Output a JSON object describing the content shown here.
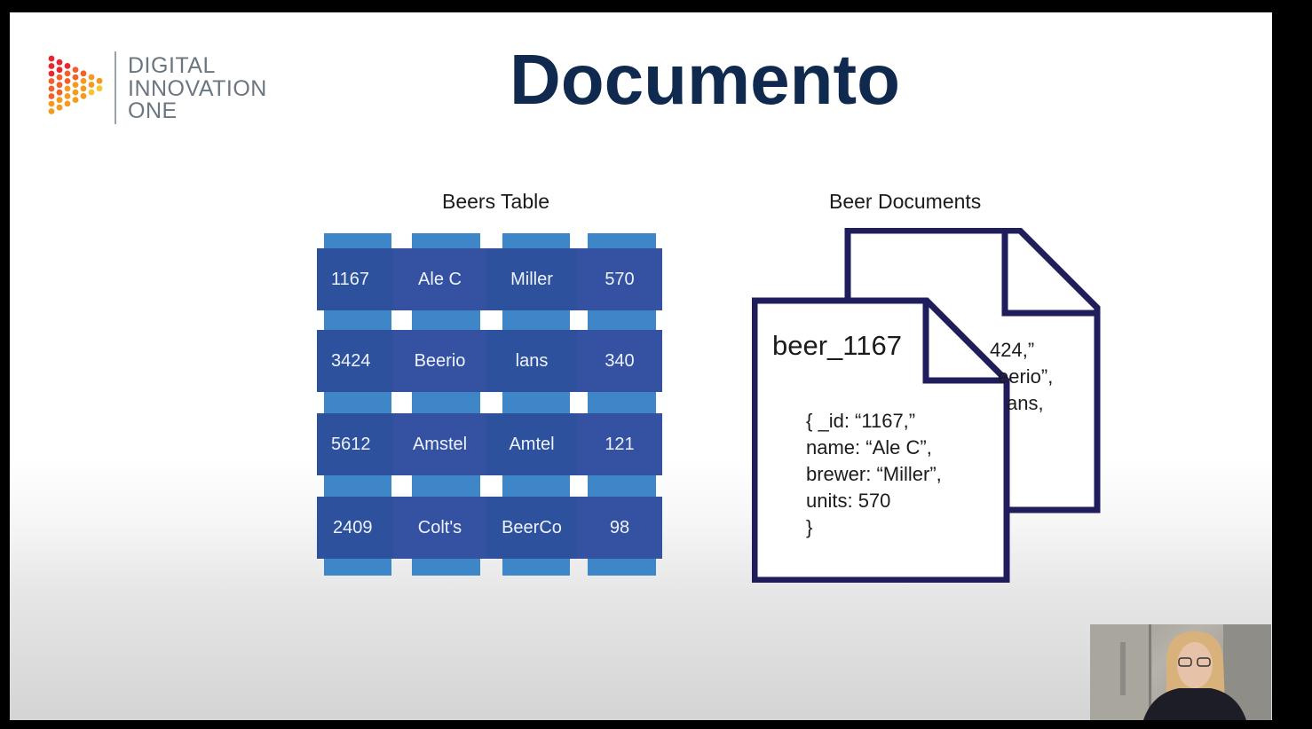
{
  "logo": {
    "lines": [
      "DIGITAL",
      "INNOVATION",
      "ONE"
    ],
    "icon": "dot-triangle-logo-icon",
    "colors": [
      "#e8262f",
      "#f2612a",
      "#f39a1f",
      "#f7c52c"
    ]
  },
  "slide": {
    "title": "Documento",
    "table_heading": "Beers Table",
    "docs_heading": "Beer Documents"
  },
  "table": {
    "rows": [
      [
        "1167",
        "Ale C",
        "Miller",
        "570"
      ],
      [
        "3424",
        "Beerio",
        "lans",
        "340"
      ],
      [
        "5612",
        "Amstel",
        "Amtel",
        "121"
      ],
      [
        "2409",
        "Colt's",
        "BeerCo",
        "98"
      ]
    ]
  },
  "document": {
    "label": "beer_1167",
    "lines": [
      "{ _id: “1167,”",
      "name: “Ale C”,",
      "brewer: “Miller”,",
      "units: 570",
      "}"
    ],
    "back_fragments": [
      "424,”",
      "eerio”,",
      "ans,"
    ]
  },
  "colors": {
    "title": "#0f2a4e",
    "cell": "#2d519c",
    "strip": "#3f86c9",
    "doc_outline": "#1f1d5c"
  }
}
